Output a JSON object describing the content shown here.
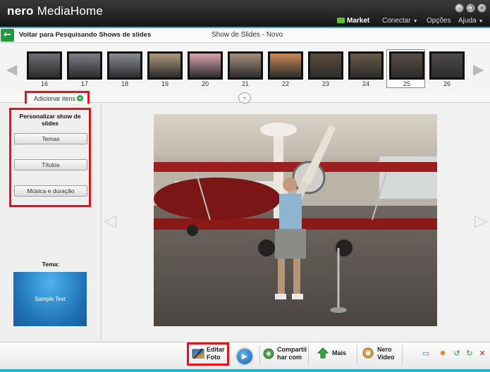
{
  "app": {
    "brand": "nero",
    "name": "MediaHome"
  },
  "window": {
    "minimize": "–",
    "restore": "❐",
    "close": "✕"
  },
  "menu": {
    "market": "Market",
    "connect": "Conectar",
    "options": "Opções",
    "help": "Ajuda"
  },
  "nav": {
    "back_label": "Voltar para Pesquisando Shows de slides",
    "page_title": "Show de Slides - Novo"
  },
  "thumbnails": [
    {
      "num": "16",
      "color": "#6c6f73"
    },
    {
      "num": "17",
      "color": "#7c7f86"
    },
    {
      "num": "18",
      "color": "#8a8d91"
    },
    {
      "num": "19",
      "color": "#b09a7e"
    },
    {
      "num": "20",
      "color": "#d9a6b0"
    },
    {
      "num": "21",
      "color": "#a88f7a"
    },
    {
      "num": "22",
      "color": "#c98a5a"
    },
    {
      "num": "23",
      "color": "#5c4d3c"
    },
    {
      "num": "24",
      "color": "#6a5a4a"
    },
    {
      "num": "25",
      "color": "#5a4f48"
    },
    {
      "num": "26",
      "color": "#4e4a4c"
    }
  ],
  "selected_thumbnail": "25",
  "add_items": {
    "label": "Adicionar itens"
  },
  "customize": {
    "title": "Personalizar show de slides",
    "themes_button": "Temas",
    "titles_button": "Títulos",
    "music_button": "Música e duração"
  },
  "theme": {
    "label": "Tema:",
    "sample_text": "Sample Text"
  },
  "toolbar": {
    "edit_photo_line1": "Editar",
    "edit_photo_line2": "Foto",
    "share_line1": "Compartil",
    "share_line2": "har com",
    "more": "Mais",
    "nero_video_line1": "Nero",
    "nero_video_line2": "Video"
  },
  "colors": {
    "accent": "#21b6c9",
    "highlight": "#e8101a",
    "back_green": "#1f9a3c"
  }
}
